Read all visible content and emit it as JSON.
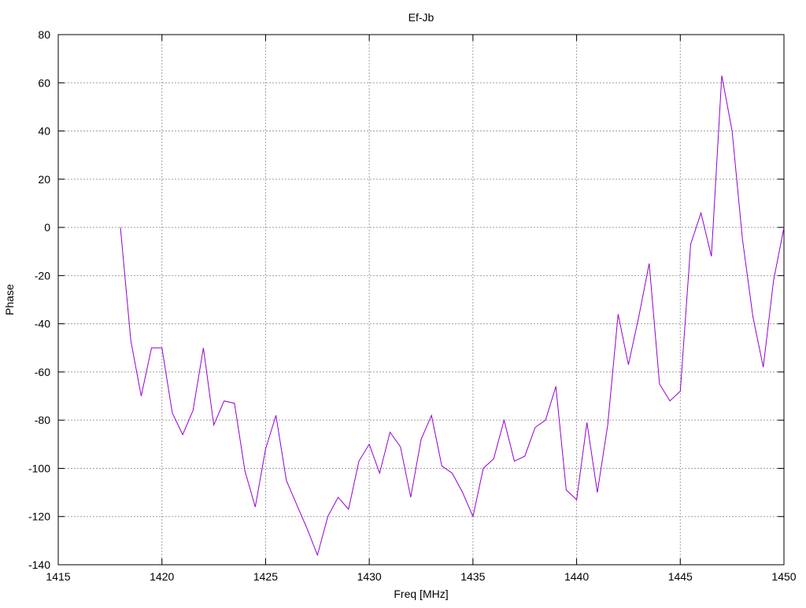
{
  "chart_data": {
    "type": "line",
    "title": "Ef-Jb",
    "xlabel": "Freq [MHz]",
    "ylabel": "Phase",
    "xlim": [
      1415,
      1450
    ],
    "ylim": [
      -140,
      80
    ],
    "xticks": [
      1415,
      1420,
      1425,
      1430,
      1435,
      1440,
      1445,
      1450
    ],
    "yticks": [
      -140,
      -120,
      -100,
      -80,
      -60,
      -40,
      -20,
      0,
      20,
      40,
      60,
      80
    ],
    "grid": true,
    "series": [
      {
        "color": "#9400d3",
        "x": [
          1418.0,
          1418.5,
          1419.0,
          1419.5,
          1420.0,
          1420.5,
          1421.0,
          1421.5,
          1422.0,
          1422.5,
          1423.0,
          1423.5,
          1424.0,
          1424.5,
          1425.0,
          1425.5,
          1426.0,
          1426.5,
          1427.0,
          1427.5,
          1428.0,
          1428.5,
          1429.0,
          1429.5,
          1430.0,
          1430.5,
          1431.0,
          1431.5,
          1432.0,
          1432.5,
          1433.0,
          1433.5,
          1434.0,
          1434.5,
          1435.0,
          1435.5,
          1436.0,
          1436.5,
          1437.0,
          1437.5,
          1438.0,
          1438.5,
          1439.0,
          1439.5,
          1440.0,
          1440.5,
          1441.0,
          1441.5,
          1442.0,
          1442.5,
          1443.0,
          1443.5,
          1444.0,
          1444.5,
          1445.0,
          1445.5,
          1446.0,
          1446.5,
          1447.0,
          1447.5,
          1448.0,
          1448.5,
          1449.0,
          1449.5,
          1450.0
        ],
        "y": [
          0,
          -47,
          -70,
          -50,
          -50,
          -77,
          -86,
          -76,
          -50,
          -82,
          -72,
          -73,
          -101,
          -116,
          -92,
          -78,
          -105,
          -115,
          -125,
          -136,
          -120,
          -112,
          -117,
          -97,
          -90,
          -102,
          -85,
          -91,
          -112,
          -88,
          -78,
          -99,
          -102,
          -110,
          -120,
          -100,
          -96,
          -80,
          -97,
          -95,
          -83,
          -80,
          -66,
          -109,
          -113,
          -81,
          -110,
          -82,
          -36,
          -57,
          -37,
          -15,
          -65,
          -72,
          -68,
          -7,
          6,
          -12,
          63,
          40,
          -5,
          -37,
          -58,
          -22,
          0
        ]
      }
    ]
  }
}
